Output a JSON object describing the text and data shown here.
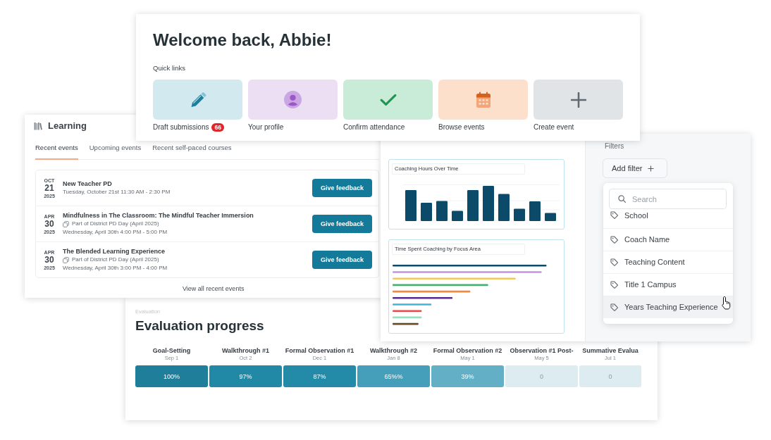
{
  "welcome": {
    "title": "Welcome back, Abbie!",
    "quick_links_heading": "Quick links",
    "quick_links": [
      {
        "label": "Draft submissions",
        "badge": "66"
      },
      {
        "label": "Your profile"
      },
      {
        "label": "Confirm attendance"
      },
      {
        "label": "Browse events"
      },
      {
        "label": "Create event"
      }
    ]
  },
  "learning": {
    "title": "Learning",
    "tabs": [
      {
        "label": "Recent events",
        "selected": true
      },
      {
        "label": "Upcoming events",
        "selected": false
      },
      {
        "label": "Recent self-paced courses",
        "selected": false
      }
    ],
    "events": [
      {
        "month": "OCT",
        "day": "21",
        "year": "2025",
        "title": "New Teacher PD",
        "time": "Tuesday, October 21st 11:30 AM - 2:30 PM",
        "button": "Give feedback"
      },
      {
        "month": "APR",
        "day": "30",
        "year": "2025",
        "title": "Mindfulness in The Classroom: The Mindful Teacher Immersion",
        "part_of": "Part of District PD Day (April 2025)",
        "time": "Wednesday, April 30th 4:00 PM - 5:00 PM",
        "button": "Give feedback"
      },
      {
        "month": "APR",
        "day": "30",
        "year": "2025",
        "title": "The Blended Learning Experience",
        "part_of": "Part of District PD Day (April 2025)",
        "time": "Wednesday, April 30th 3:00 PM - 4:00 PM",
        "button": "Give feedback"
      }
    ],
    "view_all": "View all recent events"
  },
  "dashboard": {
    "charts": [
      {
        "kind": "columns",
        "title": "Coaching Hours Over Time"
      },
      {
        "kind": "bars",
        "title": "Time Spent Coaching by Focus Area"
      }
    ],
    "filters": {
      "heading": "Filters",
      "add_button": "Add filter",
      "search": {
        "placeholder": "Search"
      },
      "options": [
        {
          "label": "School",
          "hovered": false
        },
        {
          "label": "Coach Name",
          "hovered": false
        },
        {
          "label": "Teaching Content",
          "hovered": false
        },
        {
          "label": "Title 1 Campus",
          "hovered": false
        },
        {
          "label": "Years Teaching Experience",
          "hovered": true
        }
      ]
    }
  },
  "evaluation": {
    "label": "Evaluation",
    "title": "Evaluation progress",
    "steps": [
      {
        "name": "Goal-Setting",
        "date": "Sep 1",
        "value": "100%",
        "color": "#1f7e99"
      },
      {
        "name": "Walkthrough #1",
        "date": "Oct 2",
        "value": "97%",
        "color": "#2189a6"
      },
      {
        "name": "Formal Observation #1",
        "date": "Dec 1",
        "value": "87%",
        "color": "#238aa8"
      },
      {
        "name": "Walkthrough #2",
        "date": "Jan 8",
        "value": "65%%",
        "color": "#459fba"
      },
      {
        "name": "Formal Observation #2",
        "date": "May 1",
        "value": "39%",
        "color": "#63afc6"
      },
      {
        "name": "Observation #1 Post-",
        "date": "May 5",
        "value": "0",
        "color": "#dcecf1"
      },
      {
        "name": "Summative Evalua",
        "date": "Jul 1",
        "value": "0",
        "color": "#dcecf1"
      }
    ]
  }
}
